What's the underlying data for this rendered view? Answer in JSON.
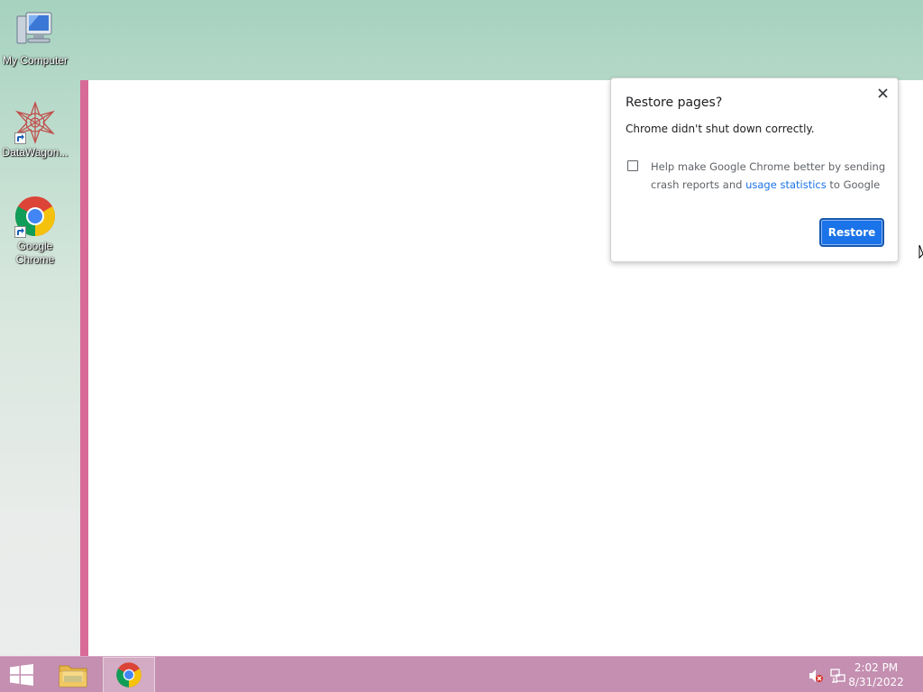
{
  "desktop": {
    "icons": [
      {
        "label": "My Computer",
        "icon": "computer-icon"
      },
      {
        "label": "DataWagon...",
        "icon": "datawagon-icon"
      },
      {
        "label": "Google Chrome",
        "icon": "chrome-icon"
      }
    ]
  },
  "dialog": {
    "title": "Restore pages?",
    "message": "Chrome didn't shut down correctly.",
    "checkbox_text_before": "Help make Google Chrome better by sending crash reports and ",
    "checkbox_link": "usage statistics",
    "checkbox_text_after": " to Google",
    "checkbox_checked": false,
    "restore_label": "Restore",
    "close_icon": "close-icon"
  },
  "taskbar": {
    "pinned": [
      {
        "name": "start",
        "icon": "windows-icon"
      },
      {
        "name": "file-explorer",
        "icon": "folder-icon"
      },
      {
        "name": "chrome",
        "icon": "chrome-icon",
        "active": true
      }
    ],
    "tray": [
      "volume-muted-icon",
      "network-icon"
    ],
    "clock": {
      "time": "2:02 PM",
      "date": "8/31/2022"
    }
  },
  "colors": {
    "accent": "#1a73e8",
    "taskbar": "#c48fb1",
    "window_border": "#d86a98"
  }
}
